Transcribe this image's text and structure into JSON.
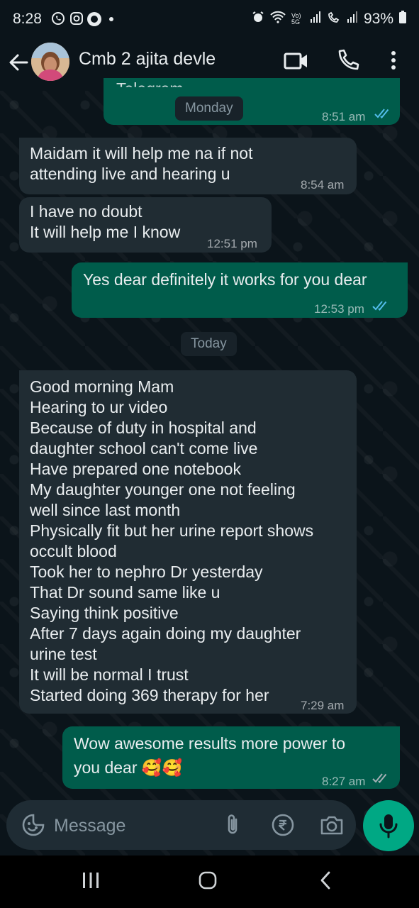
{
  "status_bar": {
    "time": "8:28",
    "network_label": "Vo) 5G",
    "battery": "93%"
  },
  "header": {
    "contact_name": "Cmb 2 ajita devle"
  },
  "messages": [
    {
      "type": "out",
      "text": "Telegram ...",
      "time": "8:51 am",
      "read": true
    },
    {
      "type": "date",
      "text": "Monday"
    },
    {
      "type": "in",
      "text": "Maidam it will help me na if not\nattending live and hearing u",
      "time": "8:54 am"
    },
    {
      "type": "in",
      "text": "I have no doubt\nIt will help me I know",
      "time": "12:51 pm"
    },
    {
      "type": "out",
      "text": "Yes dear definitely it works for you dear",
      "time": "12:53 pm",
      "read": true
    },
    {
      "type": "date",
      "text": "Today"
    },
    {
      "type": "in",
      "text": "Good morning Mam\nHearing to ur video\nBecause of duty in hospital and\ndaughter school can't come live\nHave prepared one notebook\nMy daughter younger one not feeling\nwell since last month\nPhysically fit but her urine report shows\noccult blood\nTook her to nephro Dr yesterday\nThat Dr sound same like u\nSaying think positive\nAfter 7 days again doing my daughter\nurine test\nIt will be normal I trust\nStarted doing 369 therapy for her",
      "time": "7:29 am"
    },
    {
      "type": "out",
      "text": "Wow awesome results more power to\nyou dear 🥰🥰",
      "time": "8:27 am",
      "read": false
    }
  ],
  "composer": {
    "placeholder": "Message"
  },
  "colors": {
    "incoming_bubble": "#202c33",
    "outgoing_bubble": "#005c4b",
    "read_ticks": "#53bdeb",
    "accent": "#00a884"
  }
}
